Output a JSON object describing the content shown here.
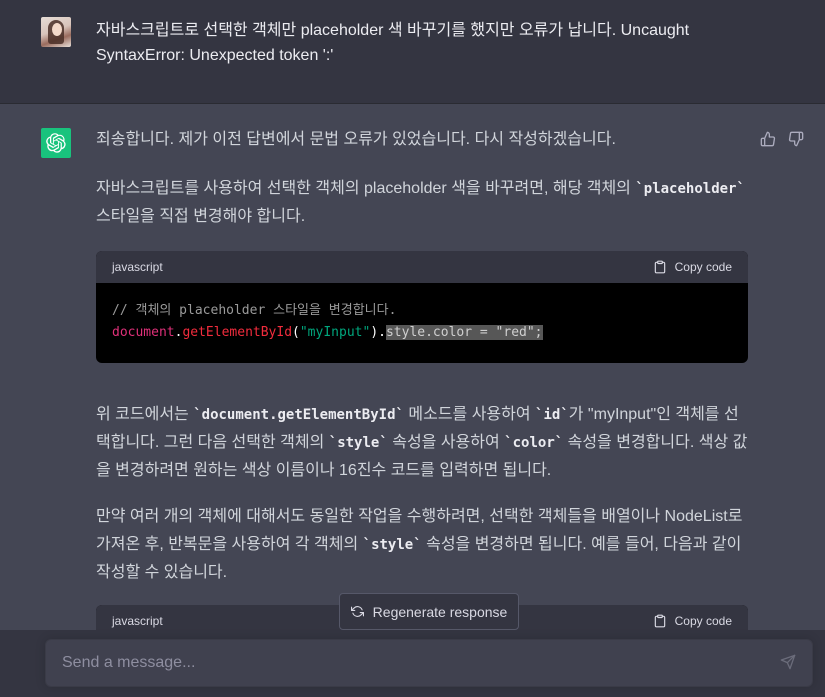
{
  "user": {
    "message": "자바스크립트로 선택한 객체만 placeholder 색 바꾸기를 했지만 오류가 납니다. Uncaught SyntaxError: Unexpected token ':'"
  },
  "assistant": {
    "intro": "죄송합니다. 제가 이전 답변에서 문법 오류가 있었습니다. 다시 작성하겠습니다.",
    "p1_before": "자바스크립트를 사용하여 선택한 객체의 placeholder 색을 바꾸려면, 해당 객체의 ",
    "p1_code": "`placeholder`",
    "p1_after": " 스타일을 직접 변경해야 합니다.",
    "code1": {
      "lang": "javascript",
      "copy": "Copy code",
      "comment": "// 객체의 placeholder 스타일을 변경합니다.",
      "obj": "document",
      "dot1": ".",
      "fn": "getElementById",
      "paren_open": "(",
      "str": "\"myInput\"",
      "paren_close": ")",
      "dot2": ".",
      "selected": "style.color = \"red\";"
    },
    "p2": {
      "t1": "위 코드에서는 ",
      "c1": "`document.getElementById`",
      "t2": " 메소드를 사용하여 ",
      "c2": "`id`",
      "t3": "가 \"myInput\"인 객체를 선택합니다. 그런 다음 선택한 객체의 ",
      "c3": "`style`",
      "t4": " 속성을 사용하여 ",
      "c4": "`color`",
      "t5": " 속성을 변경합니다. 색상 값을 변경하려면 원하는 색상 이름이나 16진수 코드를 입력하면 됩니다."
    },
    "p3": {
      "t1": "만약 여러 개의 객체에 대해서도 동일한 작업을 수행하려면, 선택한 객체들을 배열이나 NodeList로 가져온 후, 반복문을 사용하여 각 객체의 ",
      "c1": "`style`",
      "t2": " 속성을 변경하면 됩니다. 예를 들어, 다음과 같이 작성할 수 있습니다."
    },
    "code2": {
      "lang": "javascript",
      "copy": "Copy code"
    }
  },
  "regenerate": {
    "label": "Regenerate response",
    "icon": "refresh-icon"
  },
  "composer": {
    "placeholder": "Send a message..."
  },
  "colors": {
    "accent": "#19c37d",
    "user_bg": "#343541",
    "assistant_bg": "#444654"
  }
}
